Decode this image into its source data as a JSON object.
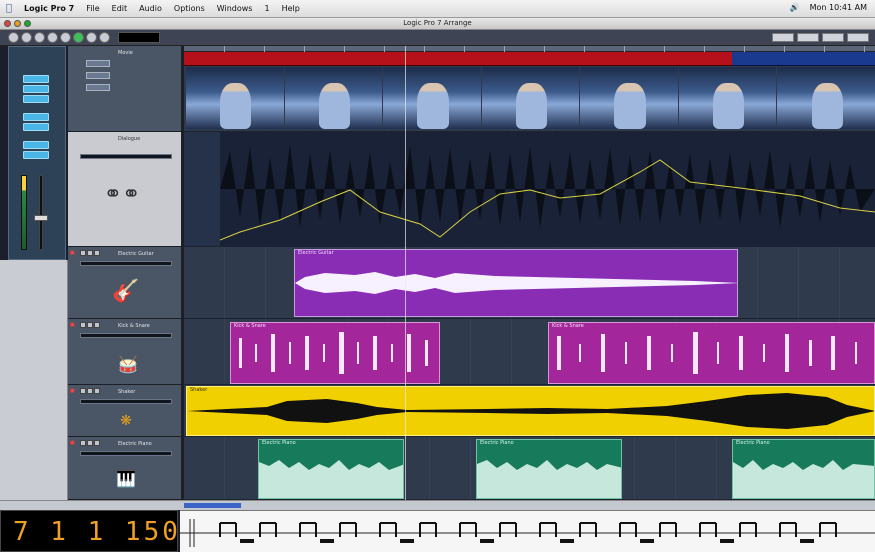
{
  "menubar": {
    "app_name": "Logic Pro 7",
    "menus": [
      "File",
      "Edit",
      "Audio",
      "Options",
      "Windows",
      "1",
      "Help"
    ],
    "clock": "Mon 10:41 AM"
  },
  "window": {
    "title": "Logic Pro 7 Arrange"
  },
  "transport": {
    "position": "7 1 1 150"
  },
  "tracks": [
    {
      "name": "Movie",
      "type": "video",
      "icon": "film-icon"
    },
    {
      "name": "Dialogue",
      "type": "audio",
      "icon": "tape-reels-icon"
    },
    {
      "name": "Electric Guitar",
      "type": "audio",
      "icon": "guitar-icon",
      "region": "Electric Guitar",
      "color": "#8a2db5"
    },
    {
      "name": "Kick & Snare",
      "type": "audio",
      "icon": "drum-icon",
      "region": "Kick & Snare",
      "color": "#a3279a"
    },
    {
      "name": "Shaker",
      "type": "audio",
      "icon": "shaker-icon",
      "region": "Shaker",
      "color": "#f0d000"
    },
    {
      "name": "Electric Piano",
      "type": "audio",
      "icon": "keyboard-icon",
      "region": "Electric Piano",
      "color": "#177a5a"
    }
  ],
  "colors": {
    "marker_red": "#b4111a",
    "marker_blue": "#1a3a8f",
    "lcd": "#f0a024",
    "accent": "#4ab6e6"
  }
}
